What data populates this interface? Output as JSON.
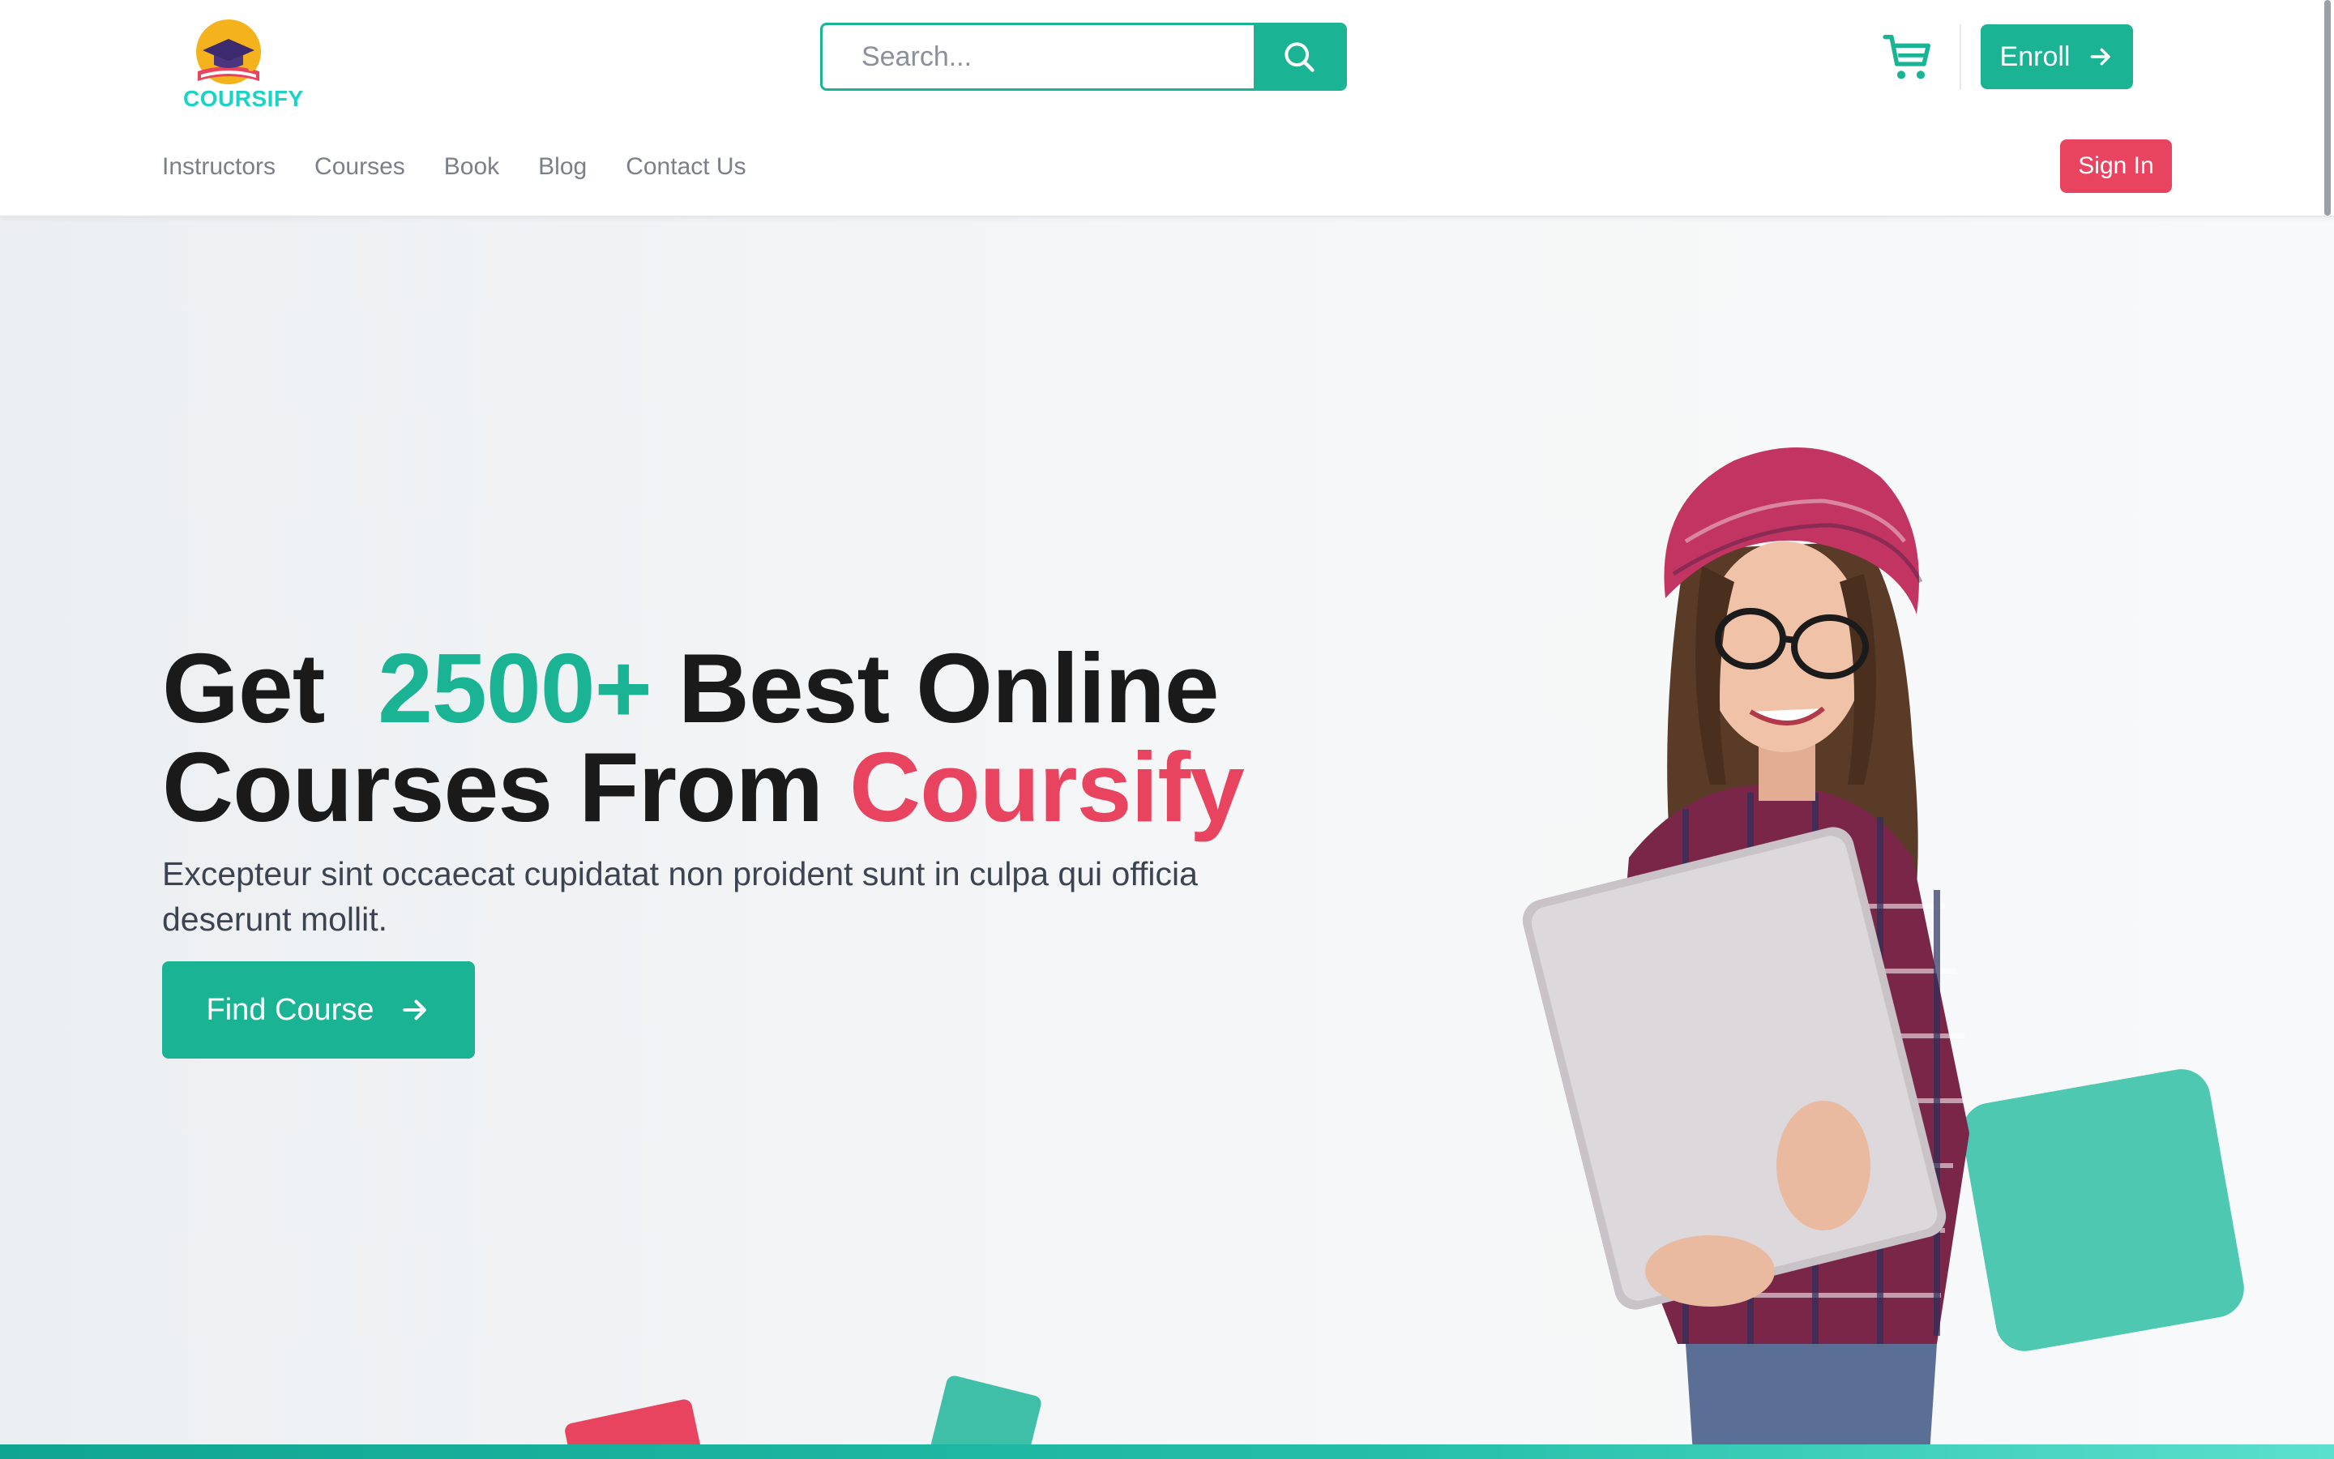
{
  "brand": {
    "name": "COURSIFY"
  },
  "search": {
    "placeholder": "Search..."
  },
  "header": {
    "enroll_label": "Enroll",
    "signin_label": "Sign In"
  },
  "nav": {
    "items": [
      {
        "label": "Instructors"
      },
      {
        "label": "Courses"
      },
      {
        "label": "Book"
      },
      {
        "label": "Blog"
      },
      {
        "label": "Contact Us"
      }
    ]
  },
  "hero": {
    "title_part1": "Get",
    "title_highlight": "2500+",
    "title_part2": "Best Online",
    "title_part3": "Courses From",
    "title_brand": "Coursify",
    "subtitle": "Excepteur sint occaecat cupidatat non proident sunt in culpa qui officia deserunt mollit.",
    "cta_label": "Find Course"
  },
  "colors": {
    "primary": "#1ab394",
    "accent": "#e8445f",
    "text_dark": "#1a1a1a",
    "text_muted": "#7b8088"
  },
  "icons": {
    "search": "search-icon",
    "cart": "cart-icon",
    "arrow": "arrow-right-icon",
    "logo": "graduation-cap-book-logo"
  }
}
